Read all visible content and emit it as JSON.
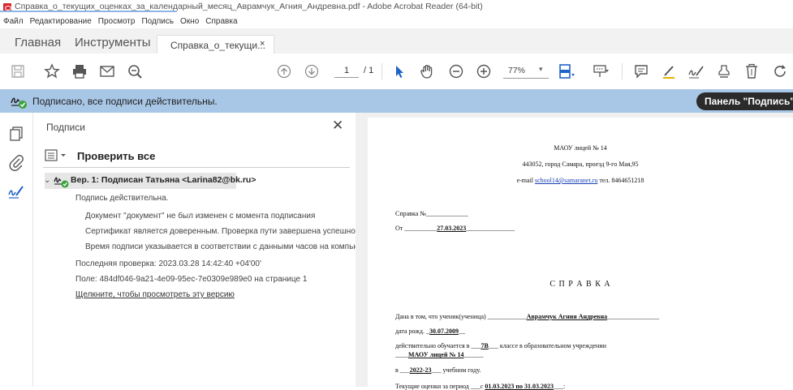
{
  "window": {
    "title": "Справка_о_текущих_оценках_за_календарный_месяц_Аврамчук_Агния_Андревна.pdf - Adobe Acrobat Reader (64-bit)"
  },
  "menu": [
    "Файл",
    "Редактирование",
    "Просмотр",
    "Подпись",
    "Окно",
    "Справка"
  ],
  "tabs": {
    "home": "Главная",
    "tools": "Инструменты",
    "document": "Справка_о_текущи...",
    "close_glyph": "×"
  },
  "toolbar": {
    "page_current": "1",
    "page_total": "/ 1",
    "zoom": "77%",
    "zoom_chevron": "▾"
  },
  "signature_bar": {
    "message": "Подписано, все подписи действительны.",
    "panel_button": "Панель \"Подпись\""
  },
  "signatures_panel": {
    "title": "Подписи",
    "close_glyph": "✕",
    "verify_all": "Проверить все",
    "entry": "Вер. 1: Подписан Татьяна <Larina82@bk.ru>",
    "details": [
      "Подпись действительна.",
      "Документ \"документ\" не был изменен с момента подписания",
      "Сертификат является доверенным. Проверка пути завершена успешно. Се",
      "Время подписи указывается в соответствии с данными часов на компьюте",
      "Последняя проверка: 2023.03.28 14:42:40 +04'00'",
      "Поле: 484df046-9a21-4e09-95ec-7e0309e989e0 на странице 1",
      "Щелкните, чтобы просмотреть эту версию"
    ]
  },
  "document": {
    "school": "МАОУ лицей № 14",
    "address": "443052, город Самара, проезд 9-го Мая,95",
    "email_prefix": "e-mail ",
    "email": "school14@samaranet.ru",
    "phone": " тел. 8464651218",
    "ref_no": "Справка №_____________",
    "date_prefix": "От __________",
    "date": "27.03.2023",
    "date_suffix": "_______________",
    "heading": "С П Р А В К А",
    "line1_prefix": "Дана в том, что ученик(ученица) ____________",
    "student": "Аврамчук Агния Андревна",
    "line1_suffix": "________________",
    "dob_prefix": "дата рожд. _",
    "dob": "30.07.2009",
    "dob_suffix": "__",
    "study_prefix": "действительно обучается в ___",
    "class": "7В",
    "study_suffix": "___ классе в образовательном учреждении",
    "inst_prefix": "____",
    "institution": "МАОУ лицей № 14",
    "inst_suffix": "______",
    "year_prefix": "в ___",
    "year": "2022-23",
    "year_suffix": "___ учебном году.",
    "grades_prefix": "Текущие оценки за период ___с ",
    "grades_period": "01.03.2023 по 31.03.2023",
    "grades_suffix": "___:"
  }
}
